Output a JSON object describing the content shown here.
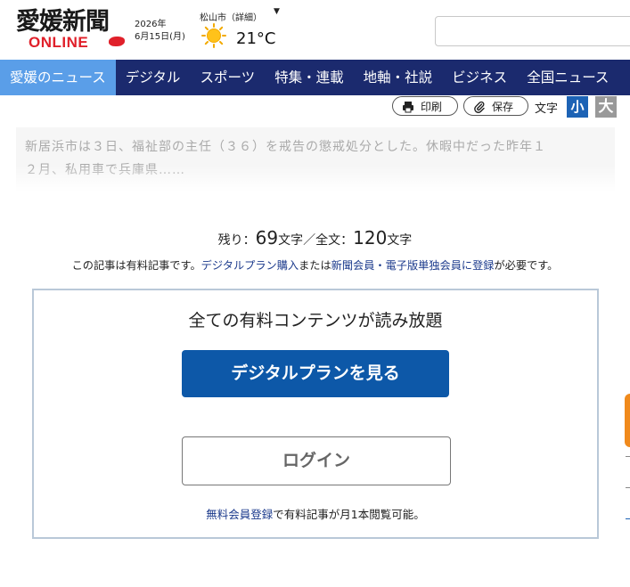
{
  "header": {
    "logo_main": "愛媛新聞",
    "logo_sub": "ONLINE",
    "date_year": "2026年",
    "date_day": "6月15日(月)",
    "weather_city": "松山市（詳細）",
    "weather_caret": "▼",
    "weather_icon": "sun-icon",
    "temperature": "21°C",
    "search_placeholder": ""
  },
  "nav": {
    "items": [
      {
        "label": "愛媛のニュース",
        "active": true
      },
      {
        "label": "デジタル"
      },
      {
        "label": "スポーツ"
      },
      {
        "label": "特集・連載"
      },
      {
        "label": "地軸・社説"
      },
      {
        "label": "ビジネス"
      },
      {
        "label": "全国ニュース"
      }
    ]
  },
  "toolbar": {
    "print_label": "印刷",
    "save_label": "保存",
    "font_size_label": "文字",
    "font_small": "小",
    "font_large": "大"
  },
  "article": {
    "excerpt_line1": "新居浜市は３日、福祉部の主任（３６）を戒告の懲戒処分とした。休暇中だった昨年１",
    "excerpt_line2": "２月、私用車で兵庫県……"
  },
  "paywall": {
    "remain_prefix": "残り：",
    "remain_count": "69",
    "remain_mid": "文字／全文：",
    "total_count": "120",
    "remain_suffix": "文字",
    "notice_1": "この記事は有料記事です。",
    "notice_link1": "デジタルプラン購入",
    "notice_2": "または",
    "notice_link2": "新聞会員・電子版単独会員に登録",
    "notice_3": "が必要です。",
    "headline": "全ての有料コンテンツが読み放題",
    "plan_button": "デジタルプランを見る",
    "login_button": "ログイン",
    "free_link": "無料会員登録",
    "free_text": "で有料記事が月1本閲覧可能。"
  },
  "colors": {
    "nav_bg": "#1b2a6e",
    "nav_active": "#5a9ee8",
    "brand_red": "#e0202a",
    "primary_button": "#0d58a8"
  }
}
